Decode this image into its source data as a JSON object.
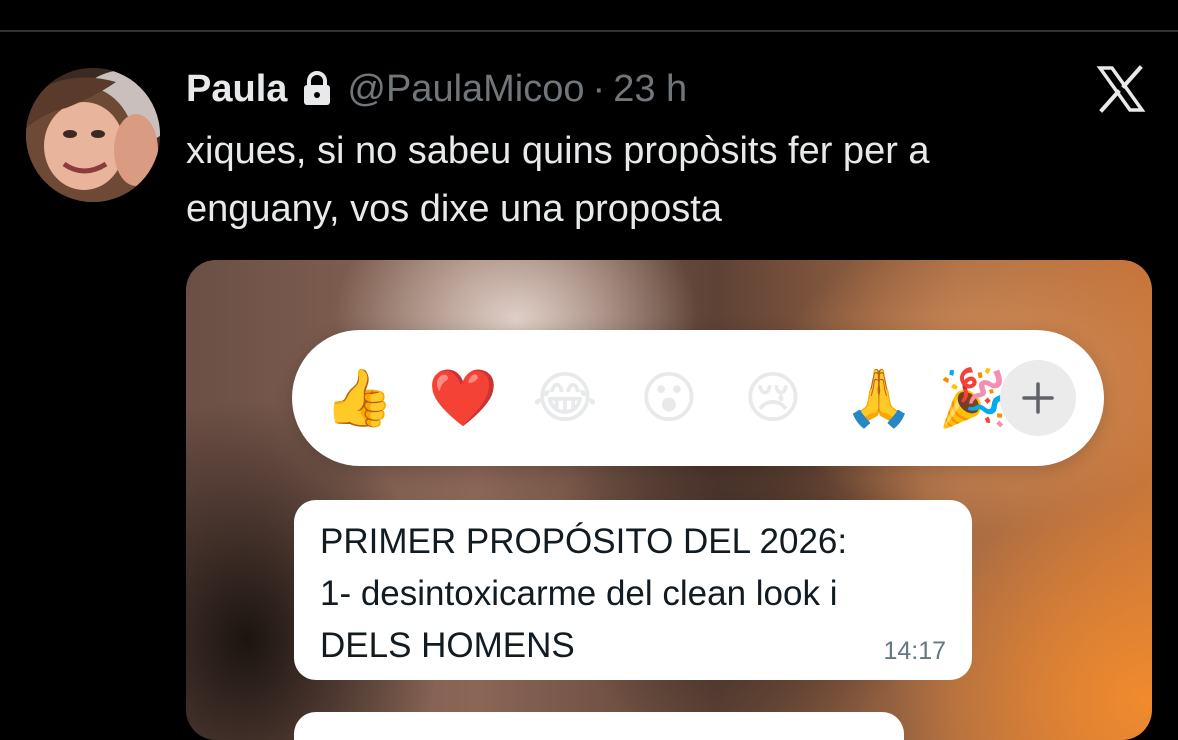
{
  "tweet": {
    "author_name": "Paula",
    "handle": "@PaulaMicoo",
    "separator": "·",
    "time": "23 h",
    "text": "xiques, si no sabeu quins propòsits fer per a enguany, vos dixe una proposta",
    "protected": true
  },
  "app": {
    "logo": "x-logo-icon"
  },
  "media": {
    "reactions": [
      {
        "emoji": "👍",
        "icon": "thumbs-up-icon"
      },
      {
        "emoji": "❤️",
        "icon": "red-heart-icon"
      },
      {
        "emoji": "😂",
        "icon": "tears-of-joy-icon"
      },
      {
        "emoji": "😮",
        "icon": "surprised-face-icon"
      },
      {
        "emoji": "😢",
        "icon": "crying-face-icon"
      },
      {
        "emoji": "🙏",
        "icon": "folded-hands-icon"
      },
      {
        "emoji": "🎉",
        "icon": "party-popper-icon"
      }
    ],
    "add_reaction": "+",
    "message": {
      "lines": [
        "PRIMER PROPÓSITO DEL 2026:",
        "1- desintoxicarme del clean look i",
        "DELS HOMENS"
      ],
      "time": "14:17"
    }
  },
  "colors": {
    "background": "#000000",
    "primary_text": "#e7e9ea",
    "secondary_text": "#71767b",
    "bubble": "#ffffff",
    "bubble_text": "#111b21"
  }
}
